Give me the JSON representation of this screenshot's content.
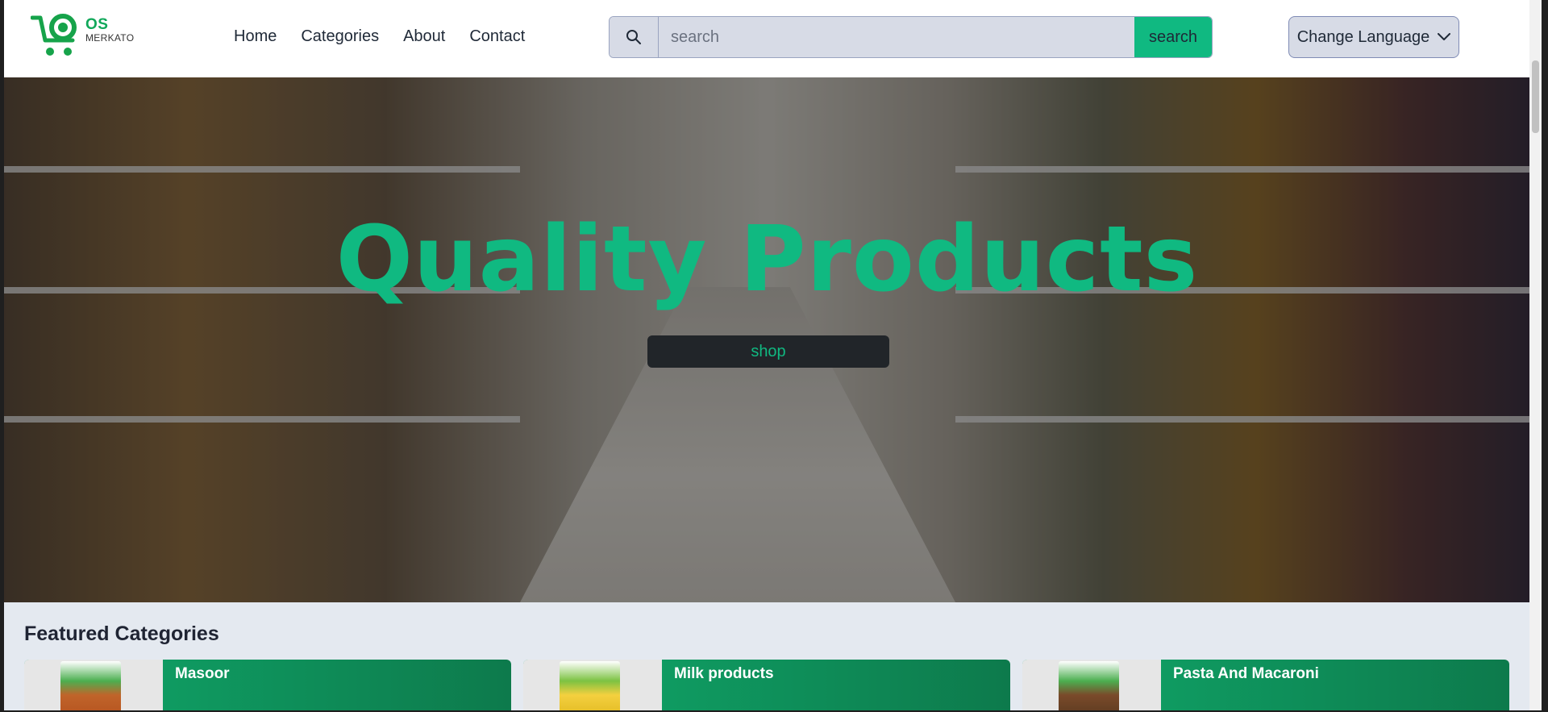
{
  "header": {
    "logo": {
      "brand_top": "OS",
      "brand_bottom": "MERKATO"
    },
    "nav": [
      {
        "label": "Home"
      },
      {
        "label": "Categories"
      },
      {
        "label": "About"
      },
      {
        "label": "Contact"
      }
    ],
    "search": {
      "placeholder": "search",
      "button_label": "search"
    },
    "language_button": "Change Language"
  },
  "hero": {
    "title": "Quality Products",
    "button_label": "shop"
  },
  "featured": {
    "title": "Featured Categories",
    "cards": [
      {
        "title": "Masoor"
      },
      {
        "title": "Milk products"
      },
      {
        "title": "Pasta And Macaroni"
      }
    ]
  },
  "colors": {
    "accent": "#10b981",
    "card_start": "#10a86a",
    "card_end": "#0d7a4c"
  }
}
